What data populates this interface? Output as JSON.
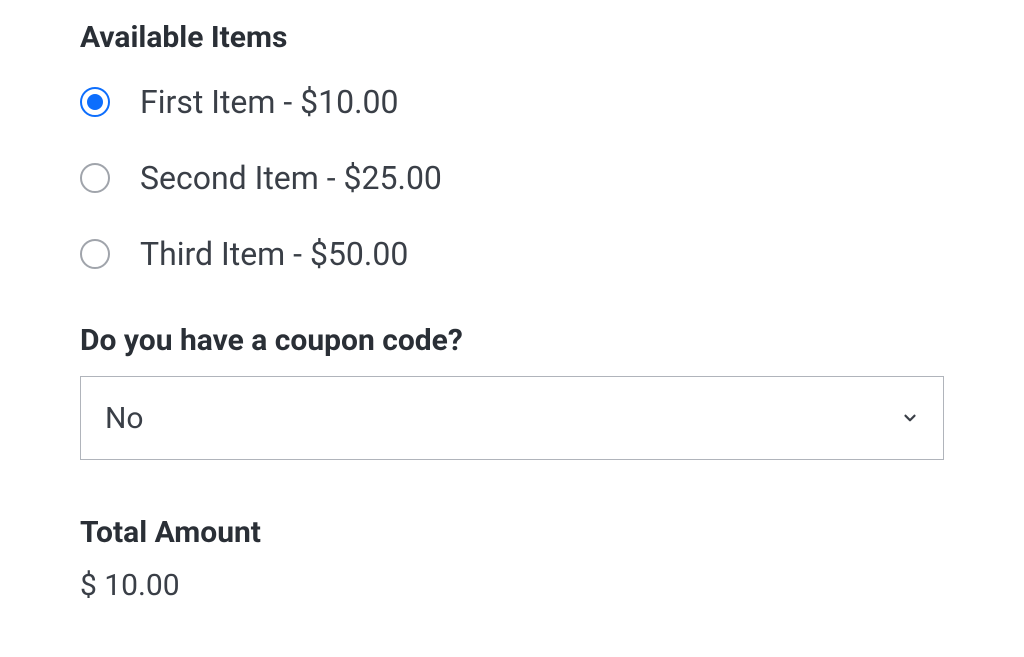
{
  "items": {
    "heading": "Available Items",
    "options": [
      {
        "label": "First Item - $10.00",
        "selected": true
      },
      {
        "label": "Second Item - $25.00",
        "selected": false
      },
      {
        "label": "Third Item - $50.00",
        "selected": false
      }
    ]
  },
  "coupon": {
    "heading": "Do you have a coupon code?",
    "selected": "No"
  },
  "total": {
    "heading": "Total Amount",
    "value": "$ 10.00"
  }
}
